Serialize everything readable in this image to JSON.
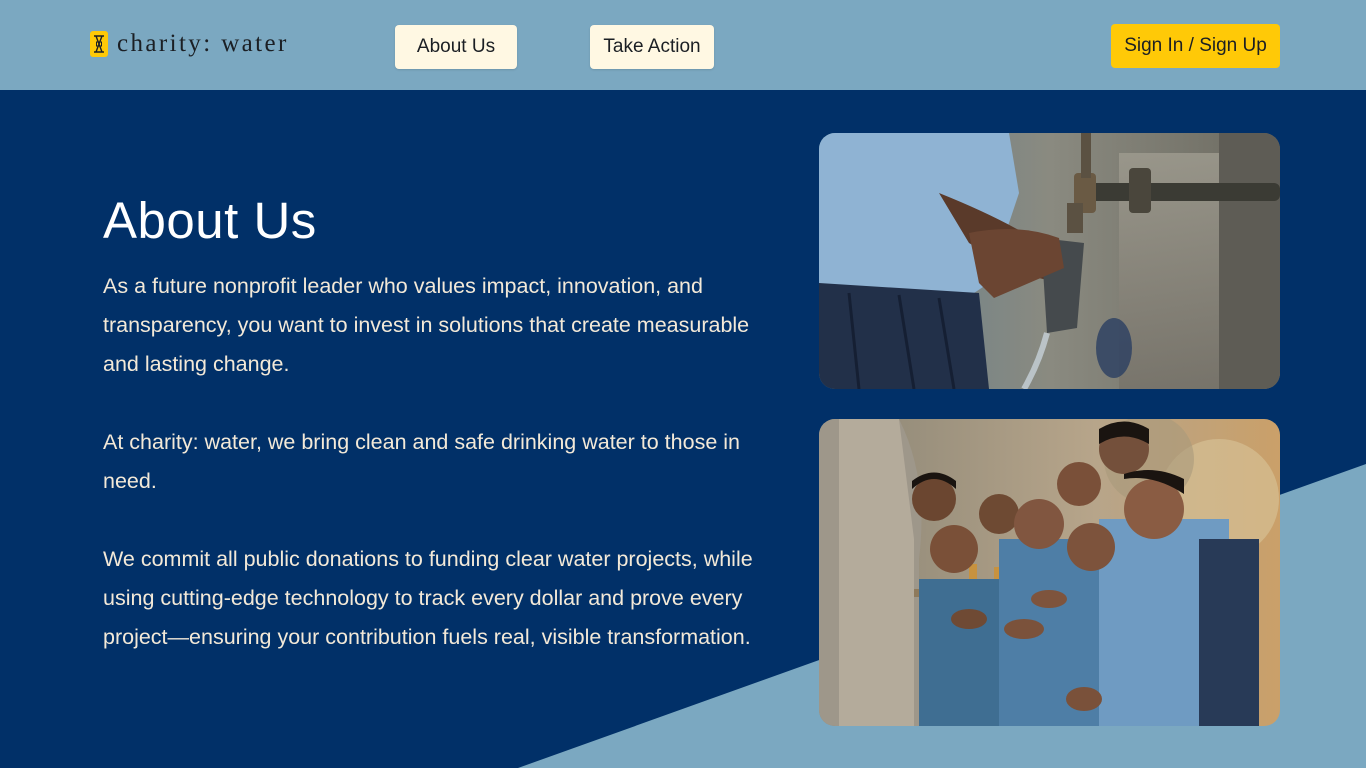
{
  "brand": {
    "logo_text": "charity: water",
    "logo_icon": "jerry-can-icon",
    "accent": "#ffc907",
    "header_bg": "#7ba8c1",
    "main_bg": "#013068"
  },
  "nav": {
    "about_label": "About Us",
    "action_label": "Take Action",
    "signin_label": "Sign In / Sign Up"
  },
  "about": {
    "title": "About Us",
    "paragraphs": [
      "As a future nonprofit leader who values impact, innovation, and transparency, you want to invest in solutions that create measurable and lasting change.",
      "At charity: water, we bring clean and safe drinking water to those in need.",
      "We commit all public donations to funding clear water projects, while using cutting-edge technology to track every dollar and prove every project—ensuring your contribution fuels real, visible transformation."
    ]
  },
  "images": {
    "photo_1": "photo-hand-filling-cup-at-tap",
    "photo_2": "photo-children-at-water-tap"
  }
}
